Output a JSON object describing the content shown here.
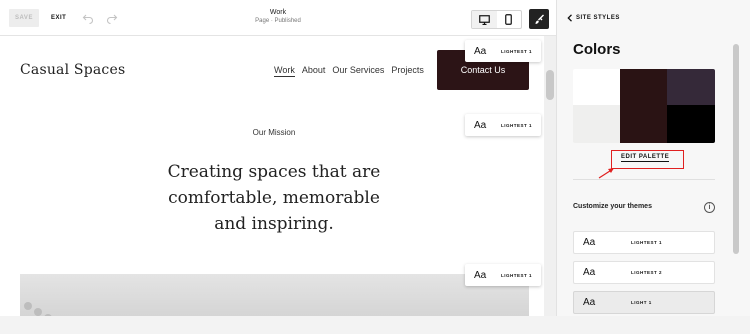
{
  "toolbar": {
    "save_label": "SAVE",
    "exit_label": "EXIT",
    "page_name": "Work",
    "page_status": "Page · Published",
    "undo_icon": "undo-icon",
    "redo_icon": "redo-icon",
    "desktop_icon": "desktop-icon",
    "mobile_icon": "mobile-icon",
    "brush_icon": "paintbrush-icon"
  },
  "site": {
    "brand": "Casual Spaces",
    "nav": [
      "Work",
      "About",
      "Our Services",
      "Projects"
    ],
    "cta_label": "Contact Us",
    "mission_label": "Our Mission",
    "headline": "Creating spaces that are comfortable, memorable and inspiring."
  },
  "section_chips": [
    {
      "aa": "Aa",
      "label": "LIGHTEST 1"
    },
    {
      "aa": "Aa",
      "label": "LIGHTEST 1"
    },
    {
      "aa": "Aa",
      "label": "LIGHTEST 1"
    }
  ],
  "panel": {
    "back_label": "SITE STYLES",
    "title": "Colors",
    "palette_colors": [
      "#ffffff",
      "#efefee",
      "#2a1314",
      "#352939",
      "#000000"
    ],
    "edit_palette_label": "EDIT PALETTE",
    "customize_label": "Customize your themes",
    "info_icon": "info-icon",
    "themes": [
      {
        "aa": "Aa",
        "label": "LIGHTEST 1"
      },
      {
        "aa": "Aa",
        "label": "LIGHTEST 2"
      },
      {
        "aa": "Aa",
        "label": "LIGHT 1"
      }
    ]
  }
}
